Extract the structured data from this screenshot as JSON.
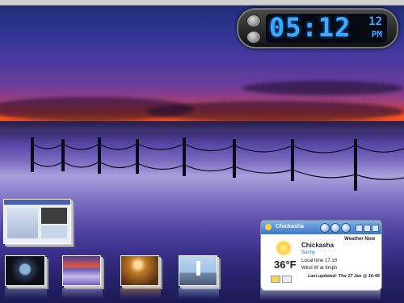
{
  "clock": {
    "time": "05:12",
    "seconds": "12",
    "ampm": "PM"
  },
  "weather": {
    "city_header": "Chickasha",
    "label": "Weather Now",
    "city": "Chickasha",
    "condition": "Sunny",
    "temperature": "36°F",
    "local_time": "Local time 17:18",
    "wind": "Wind W at 6mph",
    "last_updated": "Last updated: Thu 17 Jan @ 16:48"
  },
  "thumbnails": [
    {
      "name": "window-browser"
    },
    {
      "name": "wallpaper-dark-radial"
    },
    {
      "name": "wallpaper-sunset-fence"
    },
    {
      "name": "wallpaper-bronze-water"
    },
    {
      "name": "wallpaper-lighthouse"
    }
  ],
  "icons": {
    "clock_buttons": [
      "settings-icon",
      "close-icon"
    ],
    "weather_controls": [
      "refresh-icon",
      "globe-icon",
      "options-icon"
    ]
  }
}
